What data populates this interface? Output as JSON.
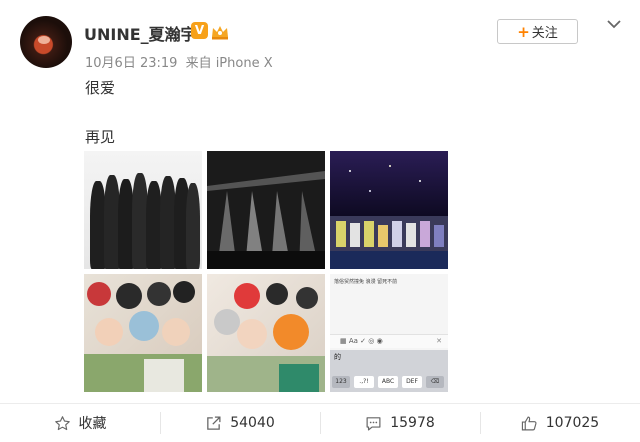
{
  "user": {
    "name": "UNINE_夏瀚宇",
    "vip_badge": "V",
    "date": "10月6日 23:19",
    "source": "来自 iPhone X"
  },
  "follow_label": "关注",
  "post": {
    "line1": "很爱",
    "line2": "再见"
  },
  "screenshot_text": "落俗贸然撞免 浪漫 留死不前",
  "keyboard": {
    "input_char": "的",
    "keys": [
      "123",
      ".,?!",
      "ABC",
      "DEF"
    ]
  },
  "actions": {
    "favorite": "收藏",
    "repost": "54040",
    "comment": "15978",
    "like": "107025"
  },
  "colors": {
    "accent": "#ff8200",
    "vip": "#f7a11a"
  }
}
